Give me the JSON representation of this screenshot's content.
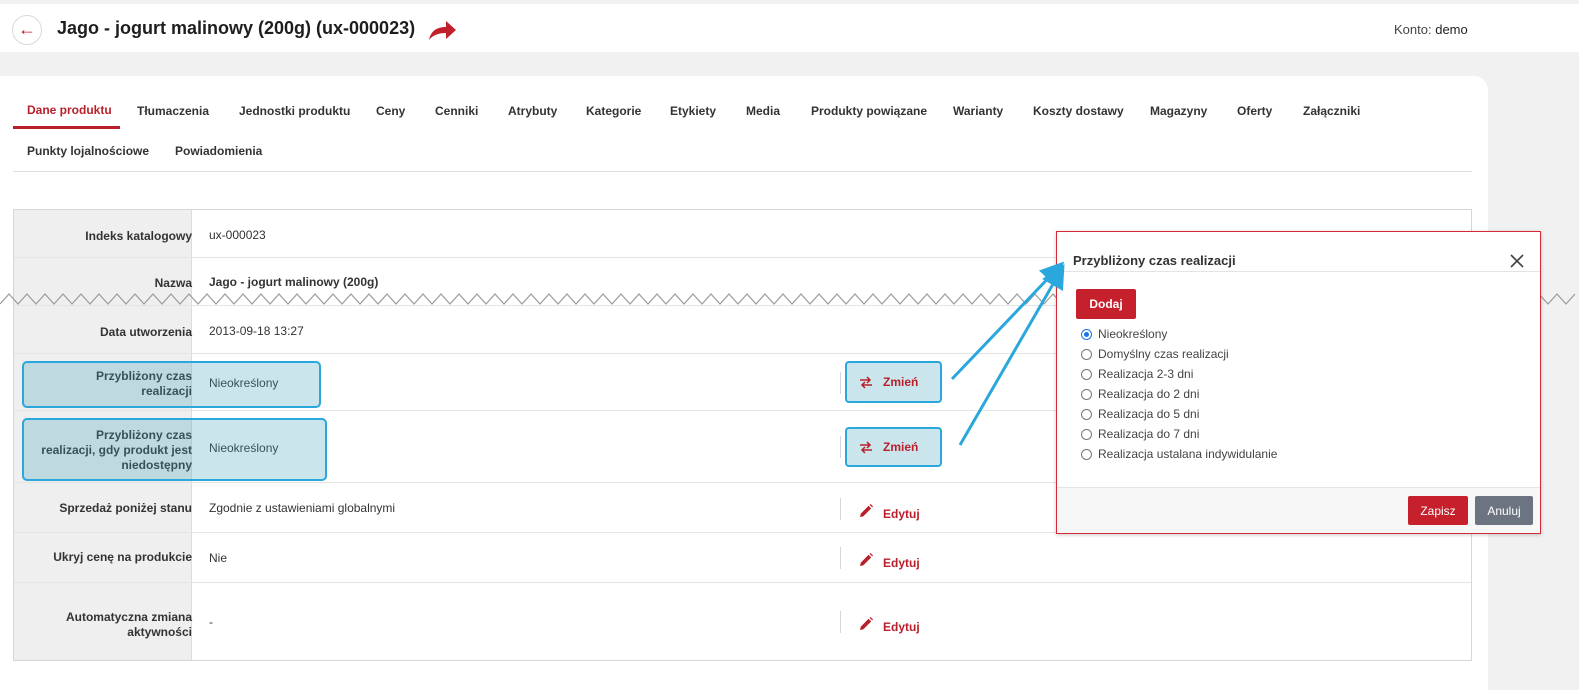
{
  "header": {
    "back_icon": "arrow-left-icon",
    "title": "Jago - jogurt malinowy (200g) (ux-000023)",
    "account_label": "Konto:",
    "account_value": "demo"
  },
  "tabs": [
    {
      "label": "Dane produktu",
      "active": true
    },
    {
      "label": "Tłumaczenia"
    },
    {
      "label": "Jednostki produktu"
    },
    {
      "label": "Ceny"
    },
    {
      "label": "Cenniki"
    },
    {
      "label": "Atrybuty"
    },
    {
      "label": "Kategorie"
    },
    {
      "label": "Etykiety"
    },
    {
      "label": "Media"
    },
    {
      "label": "Produkty powiązane"
    },
    {
      "label": "Warianty"
    },
    {
      "label": "Koszty dostawy"
    },
    {
      "label": "Magazyny"
    },
    {
      "label": "Oferty"
    },
    {
      "label": "Załączniki"
    },
    {
      "label": "Punkty lojalnościowe"
    },
    {
      "label": "Powiadomienia"
    }
  ],
  "rows": [
    {
      "label": "Indeks katalogowy",
      "value": "ux-000023"
    },
    {
      "label": "Nazwa",
      "value": "Jago - jogurt malinowy (200g)"
    },
    {
      "label": "Data utworzenia",
      "value": "2013-09-18 13:27"
    },
    {
      "label_lines": [
        "Przybliżony czas",
        "realizacji"
      ],
      "value": "Nieokreślony",
      "action": "Zmień"
    },
    {
      "label_lines": [
        "Przybliżony czas",
        "realizacji, gdy produkt jest",
        "niedostępny"
      ],
      "value": "Nieokreślony",
      "action": "Zmień"
    },
    {
      "label": "Sprzedaż poniżej stanu",
      "value": "Zgodnie z ustawieniami globalnymi",
      "action": "Edytuj"
    },
    {
      "label": "Ukryj cenę na produkcie",
      "value": "Nie",
      "action": "Edytuj"
    },
    {
      "label_lines": [
        "Automatyczna zmiana",
        "aktywności"
      ],
      "value": "-",
      "action": "Edytuj"
    }
  ],
  "modal": {
    "title": "Przybliżony czas realizacji",
    "add_label": "Dodaj",
    "options": [
      {
        "label": "Nieokreślony",
        "checked": true
      },
      {
        "label": "Domyślny czas realizacji"
      },
      {
        "label": "Realizacja 2-3 dni"
      },
      {
        "label": "Realizacja do 2 dni"
      },
      {
        "label": "Realizacja do 5 dni"
      },
      {
        "label": "Realizacja do 7 dni"
      },
      {
        "label": "Realizacja ustalana indywidulanie"
      }
    ],
    "save_label": "Zapisz",
    "cancel_label": "Anuluj"
  },
  "colors": {
    "accent": "#b9202b",
    "highlight": "#2aa7dc",
    "cancel": "#6b7480"
  }
}
